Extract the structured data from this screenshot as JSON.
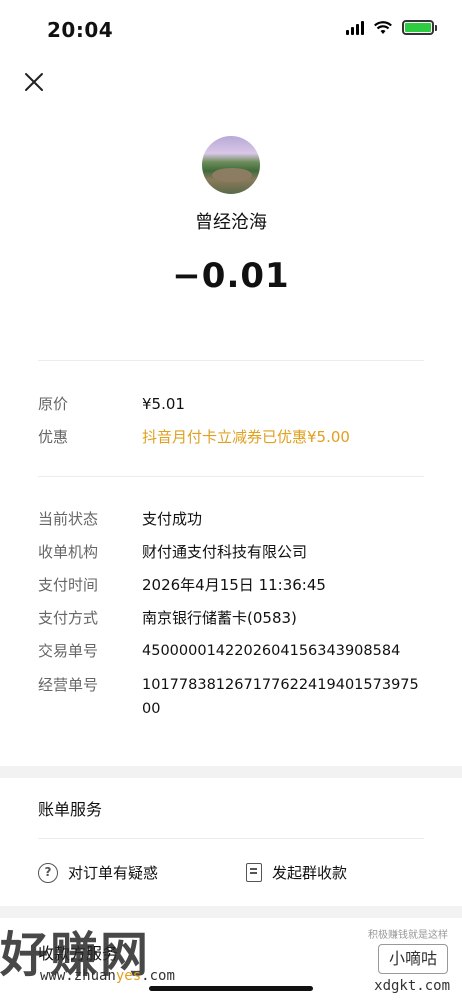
{
  "status_bar": {
    "time": "20:04"
  },
  "payee": {
    "name": "曾经沧海"
  },
  "amount": "−0.01",
  "price": {
    "original_label": "原价",
    "original_value": "¥5.01",
    "discount_label": "优惠",
    "discount_value": "抖音月付卡立减券已优惠¥5.00"
  },
  "details": [
    {
      "label": "当前状态",
      "value": "支付成功"
    },
    {
      "label": "收单机构",
      "value": "财付通支付科技有限公司"
    },
    {
      "label": "支付时间",
      "value": "2026年4月15日 11:36:45"
    },
    {
      "label": "支付方式",
      "value": "南京银行储蓄卡(0583)"
    },
    {
      "label": "交易单号",
      "value": "4500000142202604156343908584"
    },
    {
      "label": "经营单号",
      "value": "101778381267177622419401573975 00"
    }
  ],
  "services": {
    "title": "账单服务",
    "question_label": "对订单有疑惑",
    "group_collect_label": "发起群收款"
  },
  "footer_partial": "收款方服务",
  "watermark": {
    "main": "好赚网",
    "url_prefix": "www.zhuan",
    "url_highlight": "yes",
    "url_suffix": ".com",
    "right_badge": "小嘀咕",
    "right_small": "积极赚钱就是这样",
    "right_domain": "xdgkt.com"
  },
  "colors": {
    "discount": "#e0a020",
    "battery": "#2ecc40"
  }
}
